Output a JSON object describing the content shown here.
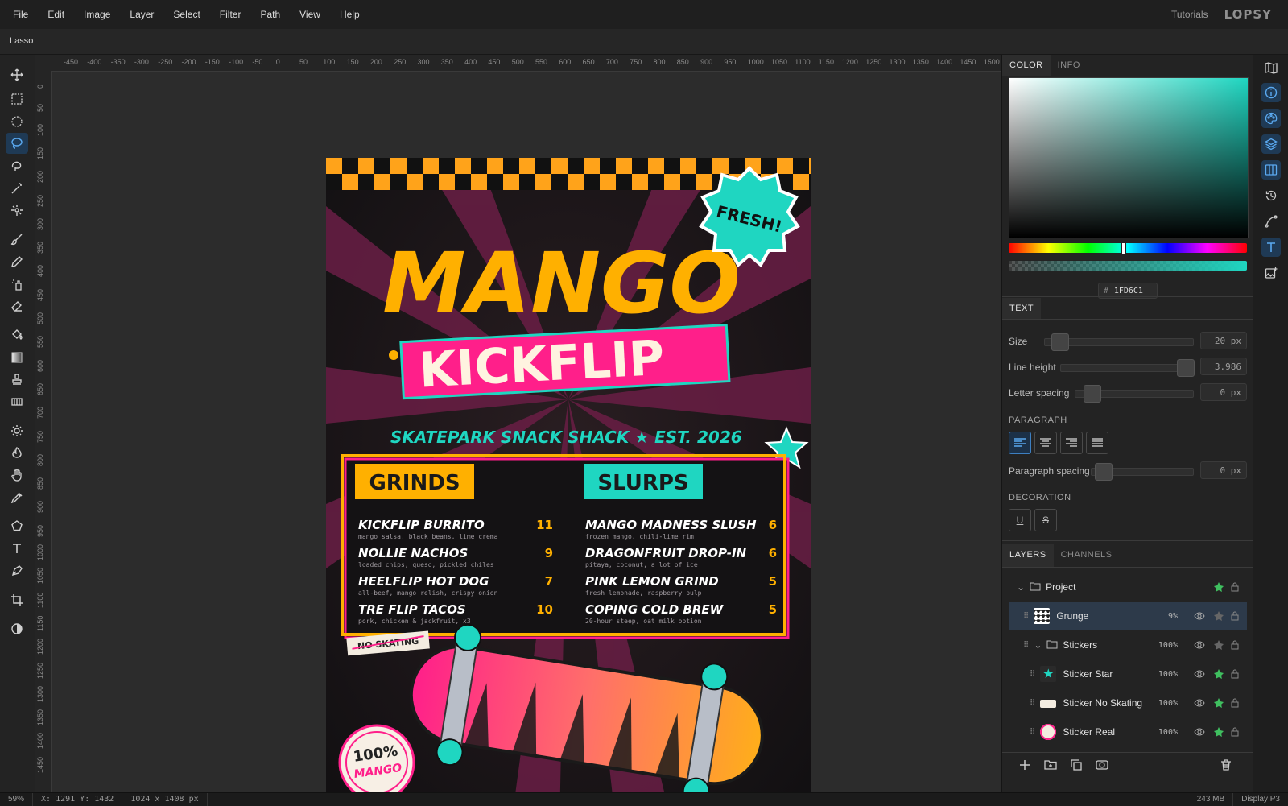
{
  "menubar": {
    "items": [
      "File",
      "Edit",
      "Image",
      "Layer",
      "Select",
      "Filter",
      "Path",
      "View",
      "Help"
    ],
    "tutorials": "Tutorials",
    "logo": "LOPSY"
  },
  "options_bar": {
    "tool_name": "Lasso"
  },
  "toolbar": {
    "tools": [
      "move-icon",
      "rect-select-icon",
      "ellipse-select-icon",
      "lasso-icon",
      "magnetic-lasso-icon",
      "magic-wand-icon",
      "quick-select-icon",
      "brush-icon",
      "pencil-icon",
      "spray-icon",
      "eraser-icon",
      "bucket-icon",
      "gradient-icon",
      "stamp-icon",
      "pattern-icon",
      "dodge-icon",
      "burn-icon",
      "hand-icon",
      "eyedropper-icon",
      "shape-icon",
      "text-icon",
      "pen-icon",
      "crop-icon",
      "contrast-icon"
    ],
    "active_tool": "lasso-icon"
  },
  "rulers": {
    "h_ticks": [
      "-450",
      "-400",
      "-350",
      "-300",
      "-250",
      "-200",
      "-150",
      "-100",
      "-50",
      "0",
      "50",
      "100",
      "150",
      "200",
      "250",
      "300",
      "350",
      "400",
      "450",
      "500",
      "550",
      "600",
      "650",
      "700",
      "750",
      "800",
      "850",
      "900",
      "950",
      "1000",
      "1050",
      "1100",
      "1150",
      "1200",
      "1250",
      "1300",
      "1350",
      "1400",
      "1450",
      "1500"
    ],
    "v_ticks": [
      "0",
      "50",
      "100",
      "150",
      "200",
      "250",
      "300",
      "350",
      "400",
      "450",
      "500",
      "550",
      "600",
      "650",
      "700",
      "750",
      "800",
      "850",
      "900",
      "950",
      "1000",
      "1050",
      "1100",
      "1150",
      "1200",
      "1250",
      "1300",
      "1350",
      "1400",
      "1450"
    ]
  },
  "poster": {
    "sticker_fresh": "FRESH!",
    "title_line1": "MANGO",
    "title_line2": "KICKFLIP",
    "subtitle": "SKATEPARK SNACK SHACK  ★  EST. 2026",
    "grinds_label": "GRINDS",
    "slurps_label": "SLURPS",
    "grinds": [
      {
        "name": "KICKFLIP BURRITO",
        "price": "11",
        "desc": "mango salsa, black beans, lime crema"
      },
      {
        "name": "NOLLIE NACHOS",
        "price": "9",
        "desc": "loaded chips, queso, pickled chiles"
      },
      {
        "name": "HEELFLIP HOT DOG",
        "price": "7",
        "desc": "all-beef, mango relish, crispy onion"
      },
      {
        "name": "TRE FLIP TACOS",
        "price": "10",
        "desc": "pork, chicken & jackfruit, x3"
      }
    ],
    "slurps": [
      {
        "name": "MANGO MADNESS SLUSH",
        "price": "6",
        "desc": "frozen mango, chili-lime rim"
      },
      {
        "name": "DRAGONFRUIT DROP-IN",
        "price": "6",
        "desc": "pitaya, coconut, a lot of ice"
      },
      {
        "name": "PINK LEMON GRIND",
        "price": "5",
        "desc": "fresh lemonade, raspberry pulp"
      },
      {
        "name": "COPING COLD BREW",
        "price": "5",
        "desc": "20-hour steep, oat milk option"
      }
    ],
    "no_skating": "NO SKATING",
    "badge_line1": "100%",
    "badge_line2": "MANGO"
  },
  "color_panel": {
    "tabs": [
      "COLOR",
      "INFO"
    ],
    "hex_prefix": "#",
    "hex_value": "1FD6C1",
    "accent": "#1FD6C1"
  },
  "text_panel": {
    "title": "TEXT",
    "size_label": "Size",
    "size_value": "20 px",
    "line_height_label": "Line height",
    "line_height_value": "3.986",
    "letter_spacing_label": "Letter spacing",
    "letter_spacing_value": "0 px",
    "paragraph_label": "PARAGRAPH",
    "paragraph_spacing_label": "Paragraph spacing",
    "paragraph_spacing_value": "0 px",
    "decoration_label": "DECORATION"
  },
  "layers_panel": {
    "tabs": [
      "LAYERS",
      "CHANNELS"
    ],
    "layers": [
      {
        "name": "Project",
        "opacity": "",
        "type": "group"
      },
      {
        "name": "Grunge",
        "opacity": "9%",
        "type": "layer"
      },
      {
        "name": "Stickers",
        "opacity": "100%",
        "type": "group"
      },
      {
        "name": "Sticker Star",
        "opacity": "100%",
        "type": "layer"
      },
      {
        "name": "Sticker No Skating",
        "opacity": "100%",
        "type": "layer"
      },
      {
        "name": "Sticker Real",
        "opacity": "100%",
        "type": "layer"
      }
    ]
  },
  "status": {
    "zoom": "59%",
    "coords": "X: 1291  Y: 1432",
    "doc_size": "1024 x 1408 px",
    "memory": "243 MB",
    "color_profile": "Display P3"
  }
}
